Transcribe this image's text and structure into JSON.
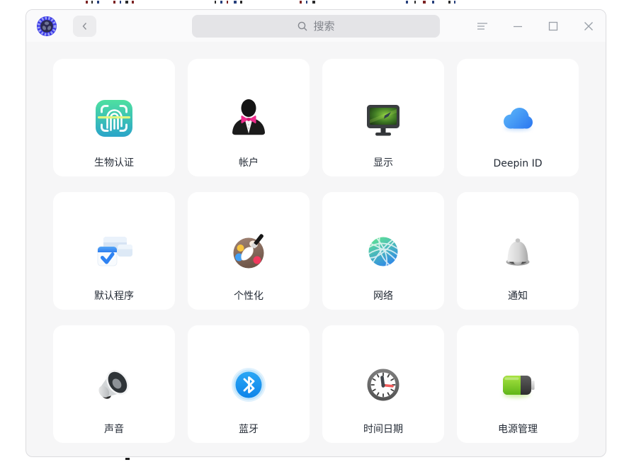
{
  "titlebar": {
    "app_icon": "control-center-logo",
    "back_icon": "chevron-left",
    "search": {
      "placeholder": "搜索",
      "value": ""
    },
    "window_controls": {
      "menu": "menu",
      "minimize": "minimize",
      "maximize": "maximize",
      "close": "close"
    }
  },
  "colors": {
    "window_bg": "#f6f6f7",
    "titlebar_bg": "#fafafb",
    "card_bg": "#ffffff",
    "search_bg": "#e4e4e7",
    "label_color": "#242b36",
    "accent_blue": "#2e82f2",
    "logo_blue": "#3c3ae8"
  },
  "grid": {
    "tiles": [
      {
        "name": "biometric-auth",
        "label": "生物认证",
        "icon": "fingerprint"
      },
      {
        "name": "accounts",
        "label": "帐户",
        "icon": "account"
      },
      {
        "name": "display",
        "label": "显示",
        "icon": "monitor"
      },
      {
        "name": "deepin-id",
        "label": "Deepin ID",
        "icon": "cloud"
      },
      {
        "name": "default-apps",
        "label": "默认程序",
        "icon": "default-apps"
      },
      {
        "name": "personalization",
        "label": "个性化",
        "icon": "palette"
      },
      {
        "name": "network",
        "label": "网络",
        "icon": "globe"
      },
      {
        "name": "notifications",
        "label": "通知",
        "icon": "bell"
      },
      {
        "name": "sound",
        "label": "声音",
        "icon": "speaker"
      },
      {
        "name": "bluetooth",
        "label": "蓝牙",
        "icon": "bluetooth"
      },
      {
        "name": "datetime",
        "label": "时间日期",
        "icon": "clock"
      },
      {
        "name": "power",
        "label": "电源管理",
        "icon": "battery"
      }
    ]
  }
}
